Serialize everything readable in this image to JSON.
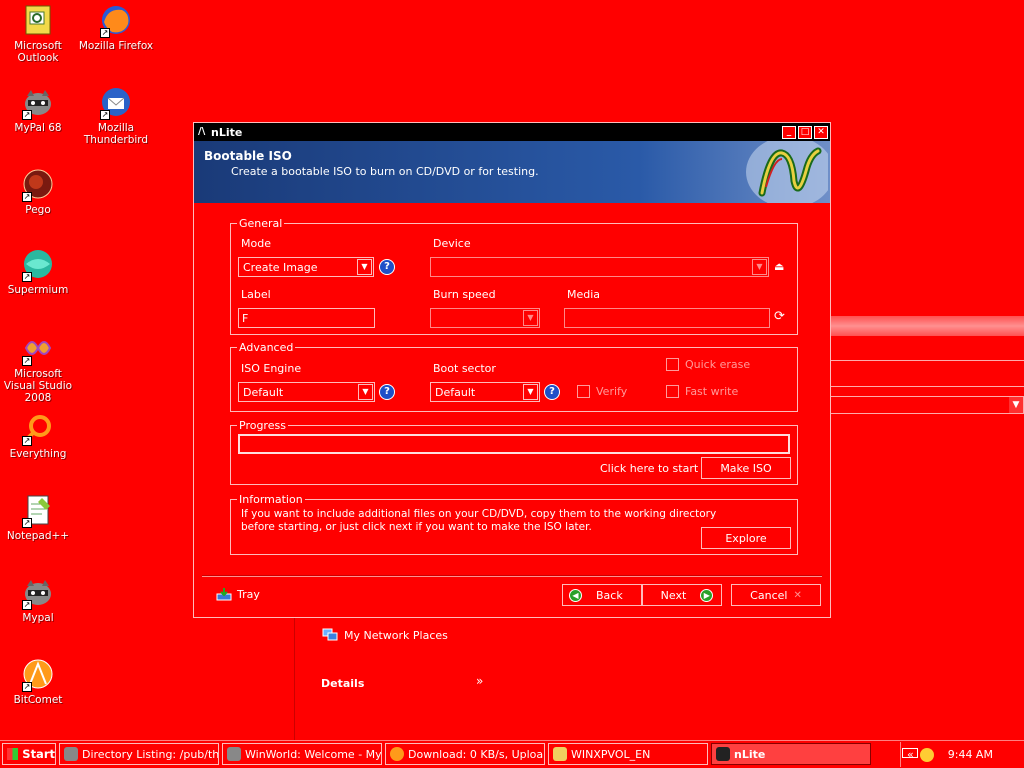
{
  "desktop": {
    "icons": [
      {
        "label": "Microsoft Outlook",
        "icon": "outlook-icon"
      },
      {
        "label": "Mozilla Firefox",
        "icon": "firefox-icon"
      },
      {
        "label": "MyPal 68",
        "icon": "mypal-icon"
      },
      {
        "label": "Mozilla Thunderbird",
        "icon": "thunderbird-icon"
      },
      {
        "label": "Pego",
        "icon": "pego-icon"
      },
      {
        "label": "Supermium",
        "icon": "supermium-icon"
      },
      {
        "label": "Microsoft Visual Studio 2008",
        "icon": "visual-studio-icon"
      },
      {
        "label": "Everything",
        "icon": "everything-icon"
      },
      {
        "label": "Notepad++",
        "icon": "notepadpp-icon"
      },
      {
        "label": "Mypal",
        "icon": "mypal-icon"
      },
      {
        "label": "BitComet",
        "icon": "bitcomet-icon"
      }
    ]
  },
  "background_window": {
    "network_places": "My Network Places",
    "details": "Details"
  },
  "window": {
    "title": "nLite",
    "header_title": "Bootable ISO",
    "header_subtitle": "Create a bootable ISO to burn on CD/DVD or for testing.",
    "general": {
      "legend": "General",
      "mode_label": "Mode",
      "mode_value": "Create Image",
      "device_label": "Device",
      "device_value": "",
      "label_label": "Label",
      "label_value": "F",
      "burn_speed_label": "Burn speed",
      "burn_speed_value": "",
      "media_label": "Media",
      "media_value": ""
    },
    "advanced": {
      "legend": "Advanced",
      "iso_engine_label": "ISO Engine",
      "iso_engine_value": "Default",
      "boot_sector_label": "Boot sector",
      "boot_sector_value": "Default",
      "verify_label": "Verify",
      "quick_erase_label": "Quick erase",
      "fast_write_label": "Fast write"
    },
    "progress": {
      "legend": "Progress",
      "value": 0,
      "hint": "Click here to start ->",
      "make_iso_label": "Make ISO"
    },
    "information": {
      "legend": "Information",
      "line1": "If you want to include additional files on your CD/DVD, copy them to the working directory",
      "line2": "before starting, or just click next if you want to make the ISO later.",
      "explore_label": "Explore"
    },
    "footer": {
      "tray_label": "Tray",
      "back_label": "Back",
      "next_label": "Next",
      "cancel_label": "Cancel"
    }
  },
  "taskbar": {
    "start_label": "Start",
    "tasks": [
      {
        "label": "Directory Listing: /pub/th...",
        "active": false
      },
      {
        "label": "WinWorld: Welcome - My...",
        "active": false
      },
      {
        "label": "Download: 0 KB/s, Uploa...",
        "active": false
      },
      {
        "label": "WINXPVOL_EN",
        "active": false
      },
      {
        "label": "nLite",
        "active": true
      }
    ],
    "tray_chevron": "«",
    "clock": "9:44 AM"
  },
  "colors": {
    "desktop": "#ff0000",
    "header_start": "#1a3a78",
    "header_end": "#6f8fc8",
    "help_blue": "#1f4fc8",
    "nav_green": "#2aa02a"
  }
}
